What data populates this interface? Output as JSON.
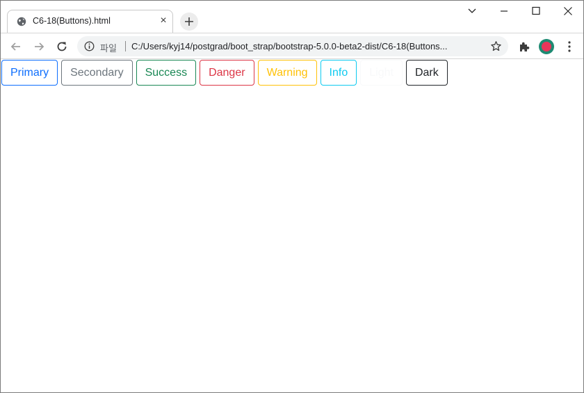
{
  "tab": {
    "title": "C6-18(Buttons).html",
    "close_glyph": "×",
    "favicon": "globe-icon"
  },
  "new_tab_glyph": "+",
  "toolbar": {
    "scheme_label": "파일",
    "url": "C:/Users/kyj14/postgrad/boot_strap/bootstrap-5.0.0-beta2-dist/C6-18(Buttons...",
    "icons": [
      "back-arrow-icon",
      "forward-arrow-icon",
      "reload-icon",
      "info-icon",
      "star-icon",
      "puzzle-extension-icon",
      "profile-avatar",
      "kebab-menu-icon"
    ]
  },
  "window_controls": [
    "chevron-down-icon",
    "minimize-icon",
    "maximize-icon",
    "close-icon"
  ],
  "buttons": [
    {
      "label": "Primary",
      "color": "#0d6efd"
    },
    {
      "label": "Secondary",
      "color": "#6c757d"
    },
    {
      "label": "Success",
      "color": "#198754"
    },
    {
      "label": "Danger",
      "color": "#dc3545"
    },
    {
      "label": "Warning",
      "color": "#ffc107"
    },
    {
      "label": "Info",
      "color": "#0dcaf0"
    },
    {
      "label": "Light",
      "color": "#f8f9fa"
    },
    {
      "label": "Dark",
      "color": "#212529"
    }
  ],
  "colors": {
    "chrome_bg": "#ffffff",
    "omnibox_bg": "#f1f3f4",
    "avatar_ring": "#1e8a72",
    "avatar_fill": "#e8355a"
  }
}
